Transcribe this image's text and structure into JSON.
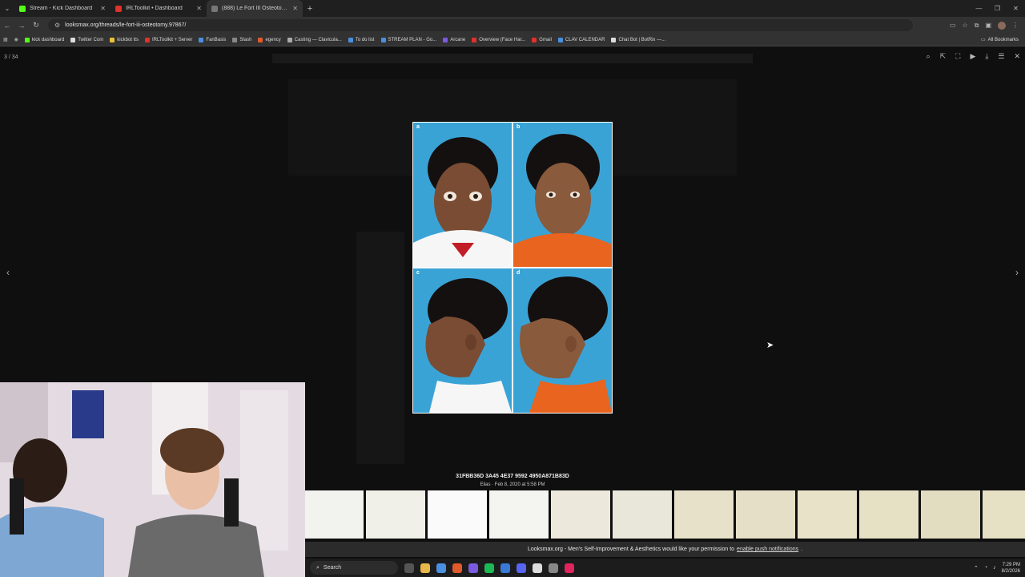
{
  "tabs": [
    {
      "title": "Stream - Kick Dashboard",
      "color": "#53fc18"
    },
    {
      "title": "IRLToolkit • Dashboard",
      "color": "#e0312b"
    },
    {
      "title": "(888) Le Fort III Osteotomy | Lo...",
      "color": "#444444"
    }
  ],
  "address": {
    "url": "looksmax.org/threads/le-fort-iii-osteotomy.97867/"
  },
  "bookmarks": [
    {
      "label": "kick dashboard",
      "color": "#53fc18"
    },
    {
      "label": "Twitter Com",
      "color": "#dddddd"
    },
    {
      "label": "kickbot tts",
      "color": "#e8c33a"
    },
    {
      "label": "IRLToolkit + Server",
      "color": "#e0312b"
    },
    {
      "label": "FanBasis",
      "color": "#4a8fe0"
    },
    {
      "label": "Slash",
      "color": "#888888"
    },
    {
      "label": "egency",
      "color": "#e05a2b"
    },
    {
      "label": "Casting — Clavicula...",
      "color": "#aaaaaa"
    },
    {
      "label": "To do list",
      "color": "#4a8fe0"
    },
    {
      "label": "STREAM PLAN - Go...",
      "color": "#4a8fe0"
    },
    {
      "label": "Arcane",
      "color": "#7a5ae0"
    },
    {
      "label": "Overview (Face Har...",
      "color": "#e0312b"
    },
    {
      "label": "Gmail",
      "color": "#e0312b"
    },
    {
      "label": "CLAV CALENDAR",
      "color": "#4a8fe0"
    },
    {
      "label": "Chat Bot | BotRix —...",
      "color": "#dddddd"
    }
  ],
  "bookmarks_all": "All Bookmarks",
  "viewer": {
    "counter": "3 / 34",
    "panels": [
      "a",
      "b",
      "c",
      "d"
    ],
    "caption_id": "31FBB36D 3A45 4E37 9592 4950A871B83D",
    "caption_meta": "Elias · Feb 8, 2020 at 5:58 PM"
  },
  "notification": {
    "text": "Looksmax.org - Men's Self-Improvement & Aesthetics would like your permission to",
    "link": "enable push notifications",
    "end": "."
  },
  "taskbar": {
    "search": "Search",
    "time": "7:29 PM",
    "date": "8/2/2026"
  }
}
